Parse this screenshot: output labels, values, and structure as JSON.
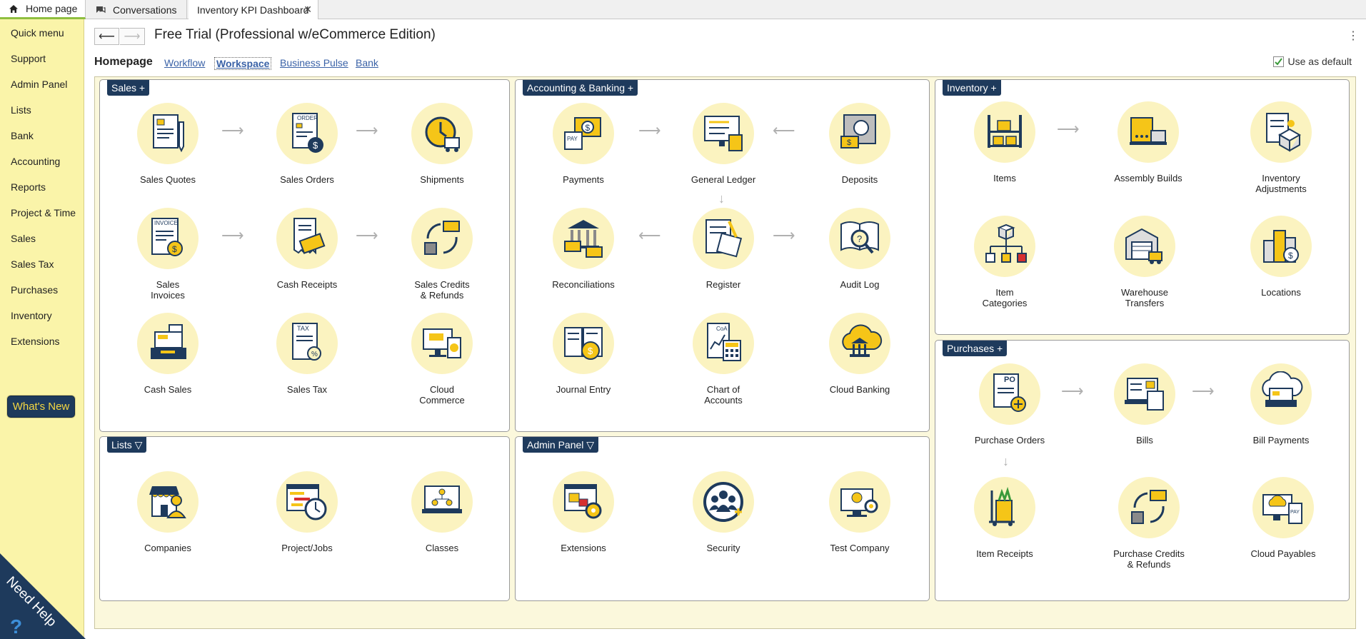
{
  "tabs": [
    {
      "label": "Home page"
    },
    {
      "label": "Conversations"
    },
    {
      "label": "Inventory KPI Dashboard"
    }
  ],
  "sidebar": {
    "items": [
      "Quick menu",
      "Support",
      "Admin Panel",
      "Lists",
      "Bank",
      "Accounting",
      "Reports",
      "Project & Time",
      "Sales",
      "Sales Tax",
      "Purchases",
      "Inventory",
      "Extensions"
    ],
    "whats_new": "What's New",
    "need_help": "Need Help"
  },
  "header": {
    "title": "Free Trial (Professional w/eCommerce Edition)"
  },
  "homepage": {
    "label": "Homepage",
    "links": [
      "Workflow",
      "Workspace",
      "Business Pulse",
      "Bank"
    ],
    "use_default": "Use as default"
  },
  "panels": {
    "sales": {
      "title": "Sales +",
      "items": [
        "Sales Quotes",
        "Sales Orders",
        "Shipments",
        "Sales\nInvoices",
        "Cash Receipts",
        "Sales Credits\n& Refunds",
        "Cash Sales",
        "Sales Tax",
        "Cloud\nCommerce"
      ]
    },
    "accounting": {
      "title": "Accounting & Banking +",
      "items": [
        "Payments",
        "General Ledger",
        "Deposits",
        "Reconciliations",
        "Register",
        "Audit Log",
        "Journal Entry",
        "Chart of\nAccounts",
        "Cloud Banking"
      ]
    },
    "inventory": {
      "title": "Inventory +",
      "items": [
        "Items",
        "Assembly Builds",
        "Inventory\nAdjustments",
        "Item\nCategories",
        "Warehouse\nTransfers",
        "Locations"
      ]
    },
    "lists": {
      "title": "Lists ▽",
      "items": [
        "Companies",
        "Project/Jobs",
        "Classes"
      ]
    },
    "admin": {
      "title": "Admin Panel ▽",
      "items": [
        "Extensions",
        "Security",
        "Test Company"
      ]
    },
    "purchases": {
      "title": "Purchases +",
      "items": [
        "Purchase Orders",
        "Bills",
        "Bill Payments",
        "Item Receipts",
        "Purchase Credits\n& Refunds",
        "Cloud Payables"
      ]
    }
  },
  "colors": {
    "sidebar_bg": "#faf4a9",
    "navy": "#1e3a5c",
    "accent_yellow": "#f5d742",
    "icon_circle": "#fbf3c0"
  }
}
